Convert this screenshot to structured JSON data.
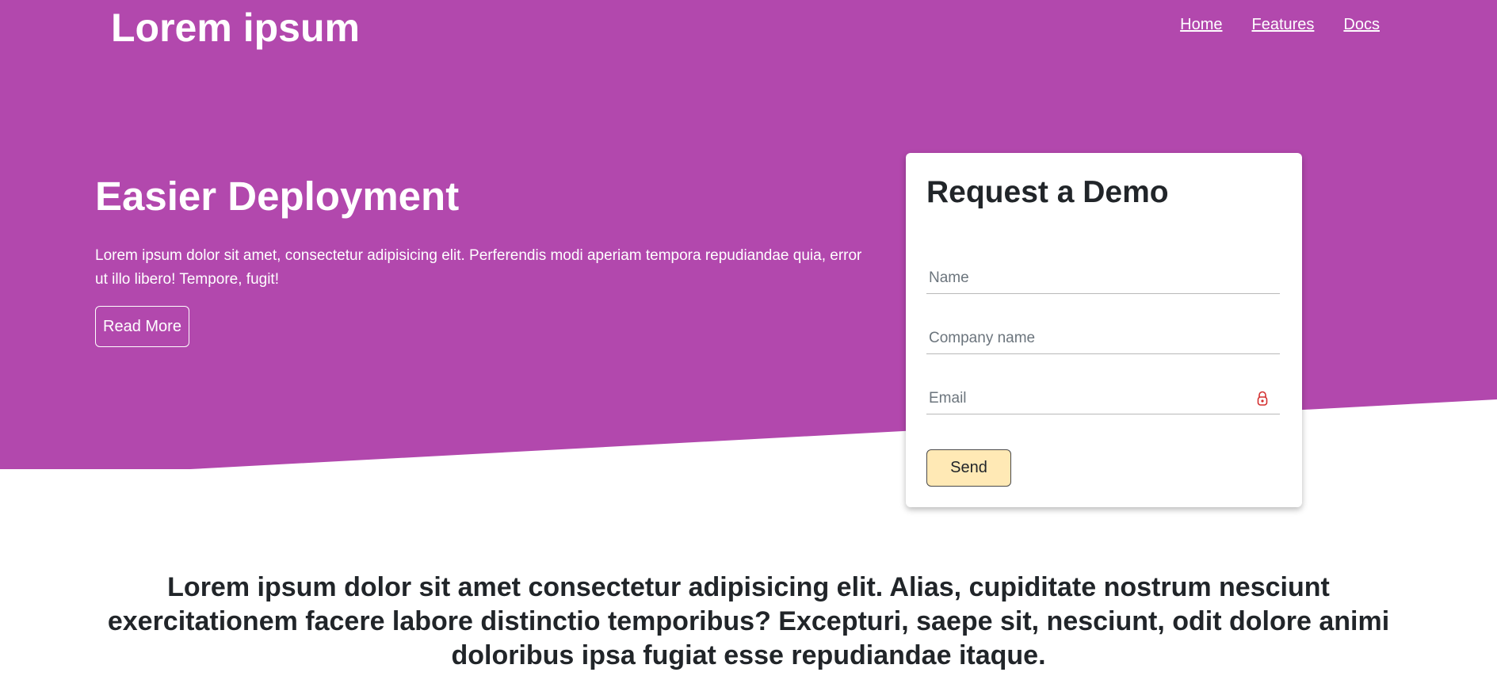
{
  "header": {
    "brand": "Lorem ipsum",
    "nav": [
      "Home",
      "Features",
      "Docs"
    ]
  },
  "hero": {
    "title": "Easier Deployment",
    "text": "Lorem ipsum dolor sit amet, consectetur adipisicing elit. Perferendis modi aperiam tempora repudiandae quia, error ut illo libero! Tempore, fugit!",
    "button_label": "Read More"
  },
  "demo_form": {
    "title": "Request a Demo",
    "name_placeholder": "Name",
    "company_placeholder": "Company name",
    "email_placeholder": "Email",
    "send_label": "Send"
  },
  "lead_text": "Lorem ipsum dolor sit amet consectetur adipisicing elit. Alias, cupiditate nostrum nesciunt exercitationem facere labore distinctio temporibus? Excepturi, saepe sit, nesciunt, odit dolore animi doloribus ipsa fugiat esse repudiandae itaque.",
  "colors": {
    "hero_background": "#b248ad",
    "send_button": "#ffe9b5",
    "text_dark": "#212529",
    "lock_icon": "#d32f2f"
  },
  "icons": {
    "email_field_icon": "lock-icon"
  }
}
